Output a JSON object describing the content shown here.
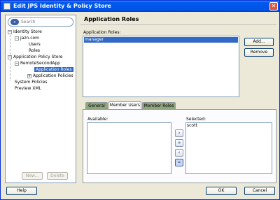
{
  "window": {
    "title": "Edit JPS Identity & Policy Store"
  },
  "search": {
    "placeholder": "Search"
  },
  "tree": [
    {
      "label": "Identity Store"
    },
    {
      "label": "jazn.com"
    },
    {
      "label": "Users"
    },
    {
      "label": "Roles"
    },
    {
      "label": "Application Policy Store"
    },
    {
      "label": "RemoteSecondApp"
    },
    {
      "label": "Application Roles"
    },
    {
      "label": "Application Policies"
    },
    {
      "label": "System Policies"
    },
    {
      "label": "Preview XML"
    }
  ],
  "left_buttons": {
    "new": "New...",
    "delete": "Delete"
  },
  "main": {
    "title": "Application Roles",
    "roles_label": "Application Roles:",
    "roles": [
      "manager"
    ],
    "add": "Add...",
    "remove": "Remove"
  },
  "tabs": [
    "General",
    "Member Users",
    "Member Roles"
  ],
  "members": {
    "available_label": "Available:",
    "selected_label": "Selected:",
    "selected": [
      "scott"
    ]
  },
  "footer": {
    "help": "Help",
    "ok": "OK",
    "cancel": "Cancel"
  },
  "colors": {
    "selection": "#316ac5",
    "tab_inactive": "#8fa57f",
    "dialog_bg": "#ece9d8"
  }
}
